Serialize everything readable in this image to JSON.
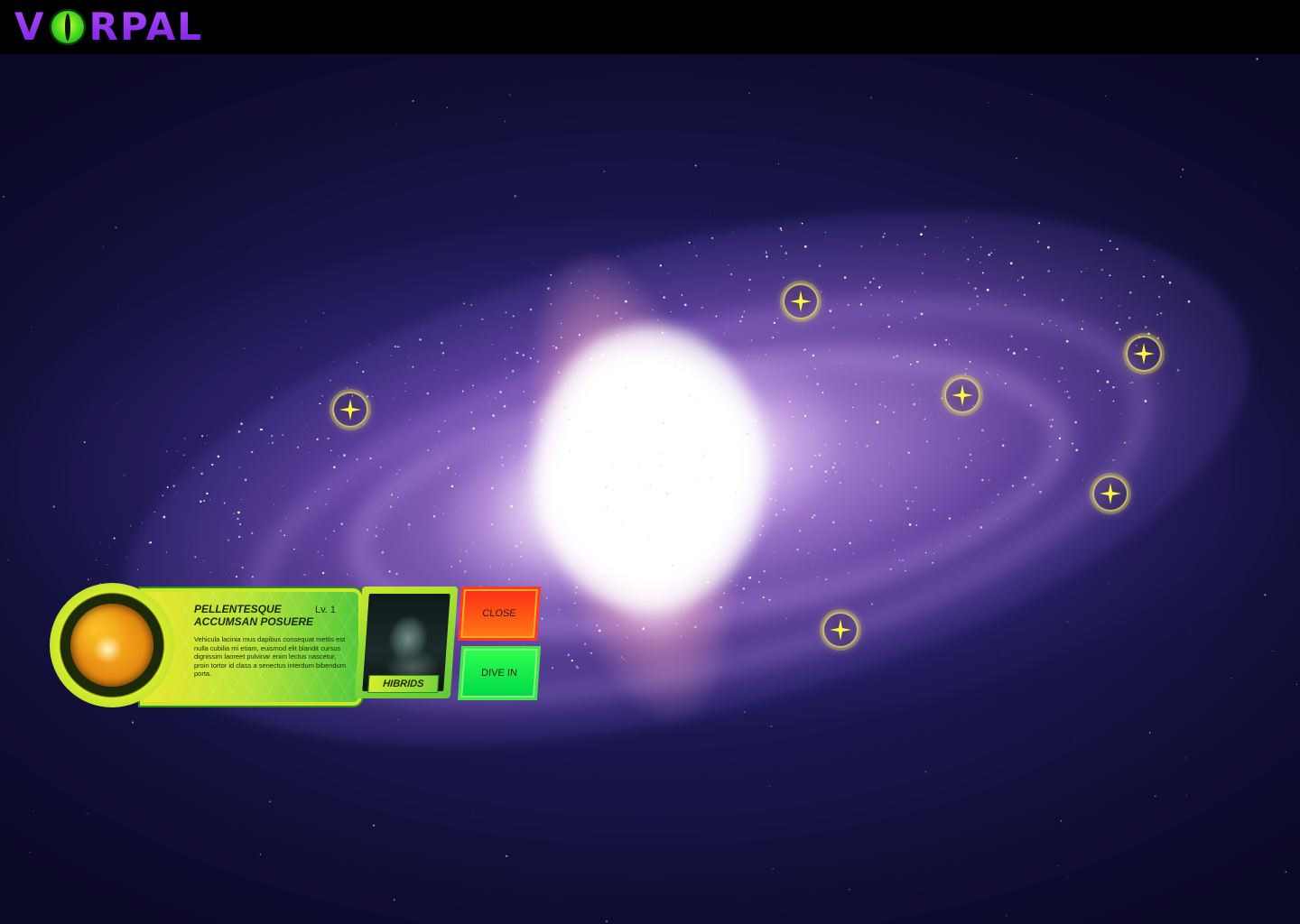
{
  "app": {
    "logo_text_left": "V",
    "logo_text_right": "RPAL"
  },
  "map": {
    "markers": [
      {
        "icon": "star-marker-icon"
      },
      {
        "icon": "star-marker-icon"
      },
      {
        "icon": "star-marker-icon"
      },
      {
        "icon": "star-marker-icon"
      },
      {
        "icon": "star-marker-icon"
      },
      {
        "icon": "star-marker-icon"
      }
    ]
  },
  "panel": {
    "title": "PELLENTESQUE\nACCUMSAN POSUERE",
    "level": "Lv. 1",
    "description": "Vehicula lacinia mus dapibus consequat mettis est nulla cubilia mi etiam, euismod elit blandit cursus dignissim laoreet pulvinar enim lectus nascetur, proin tortor id class a senectus interdum bibendum porta.",
    "faction": "HIBRIDS",
    "close_label": "CLOSE",
    "dive_label": "DIVE IN"
  },
  "colors": {
    "logo_purple": "#9b30ff",
    "panel_yellow": "#e9e82a",
    "panel_green": "#54c83a",
    "close_red": "#ff2d1a",
    "dive_green": "#00e64a",
    "marker_yellow": "#f0e65a"
  }
}
